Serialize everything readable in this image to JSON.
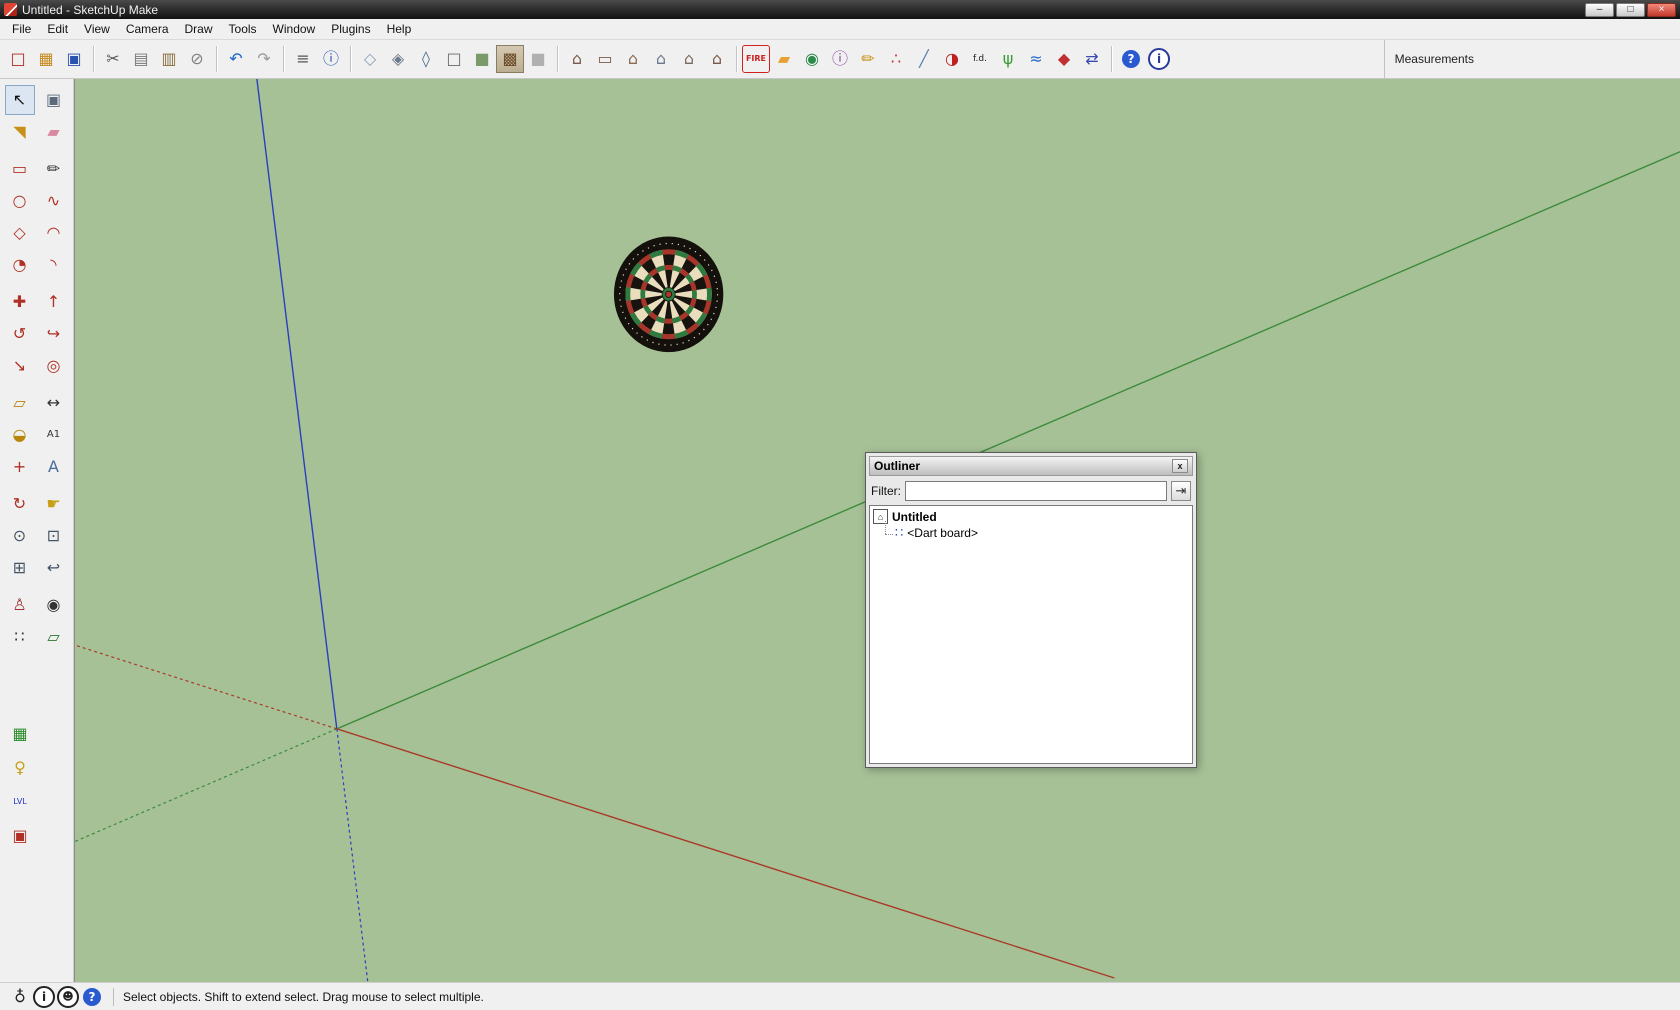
{
  "window": {
    "title": "Untitled - SketchUp Make",
    "minimize_glyph": "–",
    "maximize_glyph": "□",
    "close_glyph": "×"
  },
  "menu": {
    "items": [
      {
        "name": "menu-file",
        "label": "File"
      },
      {
        "name": "menu-edit",
        "label": "Edit"
      },
      {
        "name": "menu-view",
        "label": "View"
      },
      {
        "name": "menu-camera",
        "label": "Camera"
      },
      {
        "name": "menu-draw",
        "label": "Draw"
      },
      {
        "name": "menu-tools",
        "label": "Tools"
      },
      {
        "name": "menu-window",
        "label": "Window"
      },
      {
        "name": "menu-plugins",
        "label": "Plugins"
      },
      {
        "name": "menu-help",
        "label": "Help"
      }
    ]
  },
  "toolbar": {
    "standard_file": [
      {
        "name": "new-button",
        "glyph": "□",
        "color": "#b02a20"
      },
      {
        "name": "open-button",
        "glyph": "▦",
        "color": "#c8881e"
      },
      {
        "name": "save-button",
        "glyph": "▣",
        "color": "#2a52b0"
      }
    ],
    "standard_edit": [
      {
        "name": "cut-button",
        "glyph": "✂",
        "color": "#555555"
      },
      {
        "name": "copy-button",
        "glyph": "▤",
        "color": "#777777"
      },
      {
        "name": "paste-button",
        "glyph": "▥",
        "color": "#8a6d3b"
      },
      {
        "name": "erase-button",
        "glyph": "⊘",
        "color": "#808080"
      }
    ],
    "standard_undo": [
      {
        "name": "undo-button",
        "glyph": "↶",
        "color": "#1a66c8"
      },
      {
        "name": "redo-button",
        "glyph": "↷",
        "color": "#9a9a9a"
      }
    ],
    "standard_print": [
      {
        "name": "print-button",
        "glyph": "≡",
        "color": "#555555"
      },
      {
        "name": "model-info-button",
        "glyph": "ⓘ",
        "color": "#2a52b0"
      }
    ],
    "styles": [
      {
        "name": "style-xray-button",
        "glyph": "◇",
        "color": "#8aa0b8"
      },
      {
        "name": "style-back-edges-button",
        "glyph": "◈",
        "color": "#6a7a8a"
      },
      {
        "name": "style-wireframe-button",
        "glyph": "◊",
        "color": "#4a6a8a"
      },
      {
        "name": "style-hidden-line-button",
        "glyph": "□",
        "color": "#6a6a6a"
      },
      {
        "name": "style-shaded-button",
        "glyph": "■",
        "color": "#7a9a6a"
      },
      {
        "name": "style-shaded-textures-button",
        "glyph": "▩",
        "color": "#6a4a28",
        "cls": "tbtn pressed"
      },
      {
        "name": "style-monochrome-button",
        "glyph": "■",
        "color": "#b0b0b0"
      }
    ],
    "views": [
      {
        "name": "view-iso-button",
        "glyph": "⌂",
        "color": "#7a5a4a"
      },
      {
        "name": "view-top-button",
        "glyph": "▭",
        "color": "#7a5a4a"
      },
      {
        "name": "view-front-button",
        "glyph": "⌂",
        "color": "#8a6a50"
      },
      {
        "name": "view-right-button",
        "glyph": "⌂",
        "color": "#6a7a8a"
      },
      {
        "name": "view-back-button",
        "glyph": "⌂",
        "color": "#7a6a5a"
      },
      {
        "name": "view-left-button",
        "glyph": "⌂",
        "color": "#7a5a4a"
      }
    ],
    "plugins": [
      {
        "name": "fire-plugin-button",
        "glyph": "FIRE",
        "color": "#d02020",
        "fs": "8px",
        "cls": "tbtn boxed"
      },
      {
        "name": "folder-plugin-button",
        "glyph": "▰",
        "color": "#e8a030"
      },
      {
        "name": "add-location-button",
        "glyph": "◉",
        "color": "#2a8a4a"
      },
      {
        "name": "model-info-plugin-button",
        "glyph": "ⓘ",
        "color": "#8a4aa0"
      },
      {
        "name": "pencil-plugin-button",
        "glyph": "✏",
        "color": "#c89018"
      },
      {
        "name": "colors-plugin-button",
        "glyph": "∴",
        "color": "#c03030"
      },
      {
        "name": "eyedropper-plugin-button",
        "glyph": "╱",
        "color": "#5a80b0"
      },
      {
        "name": "contrast-plugin-button",
        "glyph": "◑",
        "color": "#c02020"
      },
      {
        "name": "fd-ruler-plugin-button",
        "glyph": "f.d.",
        "color": "#222222",
        "fs": "9px"
      },
      {
        "name": "grass-plugin-button",
        "glyph": "ψ",
        "color": "#3a9a3a"
      },
      {
        "name": "water-plugin-button",
        "glyph": "≈",
        "color": "#2a6ac8"
      },
      {
        "name": "shield-plugin-button",
        "glyph": "◆",
        "color": "#c03030"
      },
      {
        "name": "export-plugin-button",
        "glyph": "⇄",
        "color": "#3a4ab0"
      }
    ],
    "help": [
      {
        "name": "help-button",
        "glyph": "?",
        "color": "#ffffff",
        "bg": "#2a5ad0",
        "cls": "tbtn round"
      },
      {
        "name": "info-button",
        "glyph": "i",
        "color": "#2a3a9a",
        "cls": "tbtn round ring"
      }
    ],
    "measurements_label": "Measurements",
    "measurements_value": ""
  },
  "left_toolbar": {
    "principal": [
      {
        "name": "select-tool",
        "glyph": "↖",
        "color": "#111111",
        "cls": "tbtn pressed-tool"
      },
      {
        "name": "make-component-tool",
        "glyph": "▣",
        "color": "#5a6a7a"
      },
      {
        "name": "paint-bucket-tool",
        "glyph": "◥",
        "color": "#c89018"
      },
      {
        "name": "eraser-tool",
        "glyph": "▰",
        "color": "#d889a0"
      }
    ],
    "drawing": [
      {
        "name": "rectangle-tool",
        "glyph": "▭",
        "color": "#b03025"
      },
      {
        "name": "line-tool",
        "glyph": "✏",
        "color": "#333333"
      },
      {
        "name": "circle-tool",
        "glyph": "○",
        "color": "#b03025"
      },
      {
        "name": "freehand-tool",
        "glyph": "∿",
        "color": "#b03025"
      },
      {
        "name": "polygon-tool",
        "glyph": "◇",
        "color": "#b03025"
      },
      {
        "name": "arc-tool",
        "glyph": "◠",
        "color": "#b03025"
      },
      {
        "name": "pie-tool",
        "glyph": "◔",
        "color": "#b03025"
      },
      {
        "name": "two-point-arc-tool",
        "glyph": "◝",
        "color": "#b03025"
      }
    ],
    "modification": [
      {
        "name": "move-tool",
        "glyph": "✚",
        "color": "#b03025"
      },
      {
        "name": "push-pull-tool",
        "glyph": "↑",
        "color": "#b03025"
      },
      {
        "name": "rotate-tool",
        "glyph": "↺",
        "color": "#b03025"
      },
      {
        "name": "follow-me-tool",
        "glyph": "↪",
        "color": "#b03025"
      },
      {
        "name": "scale-tool",
        "glyph": "↘",
        "color": "#b03025"
      },
      {
        "name": "offset-tool",
        "glyph": "◎",
        "color": "#b03025"
      }
    ],
    "construction": [
      {
        "name": "tape-measure-tool",
        "glyph": "▱",
        "color": "#b8860b"
      },
      {
        "name": "dimension-tool",
        "glyph": "↔",
        "color": "#333333"
      },
      {
        "name": "protractor-tool",
        "glyph": "◒",
        "color": "#b8860b"
      },
      {
        "name": "text-tool",
        "glyph": "A1",
        "color": "#333333",
        "fs": "10px"
      },
      {
        "name": "axes-tool",
        "glyph": "+",
        "color": "#b03025"
      },
      {
        "name": "3d-text-tool",
        "glyph": "A",
        "color": "#4a6a9a"
      }
    ],
    "camera": [
      {
        "name": "orbit-tool",
        "glyph": "↻",
        "color": "#b03025"
      },
      {
        "name": "pan-tool",
        "glyph": "☛",
        "color": "#c8a018"
      },
      {
        "name": "zoom-tool",
        "glyph": "⊙",
        "color": "#445566"
      },
      {
        "name": "zoom-window-tool",
        "glyph": "⊡",
        "color": "#445566"
      },
      {
        "name": "zoom-extents-tool",
        "glyph": "⊞",
        "color": "#445566"
      },
      {
        "name": "zoom-previous-tool",
        "glyph": "↩",
        "color": "#445566"
      }
    ],
    "walkthrough": [
      {
        "name": "position-camera-tool",
        "glyph": "♙",
        "color": "#a03030"
      },
      {
        "name": "look-around-tool",
        "glyph": "◉",
        "color": "#333333"
      },
      {
        "name": "walk-tool",
        "glyph": "∷",
        "color": "#333333"
      },
      {
        "name": "section-plane-tool",
        "glyph": "▱",
        "color": "#2a7a2a"
      }
    ],
    "plugins": [
      {
        "name": "plugin-building-tool",
        "glyph": "▦",
        "color": "#2a8a2a"
      },
      {
        "name": "plugin-lamp-tool",
        "glyph": "♀",
        "color": "#c8a018"
      },
      {
        "name": "plugin-lvl-tool",
        "glyph": "LVL",
        "color": "#2233cc",
        "fs": "8px"
      },
      {
        "name": "plugin-box-tool",
        "glyph": "▣",
        "color": "#b03025"
      }
    ]
  },
  "viewport": {
    "background_color": "#a7c197",
    "axis_red_color": "#a83a28",
    "axis_green_color": "#3c8a3c",
    "axis_blue_color": "#2a3fbf",
    "object_label": "Dart board"
  },
  "outliner": {
    "title": "Outliner",
    "close_glyph": "x",
    "filter_label": "Filter:",
    "filter_value": "",
    "filter_go_glyph": "⇥",
    "root_icon_glyph": "⌂",
    "root_label": "Untitled",
    "child_icon_glyph": "∷",
    "child_label": "<Dart board>"
  },
  "statusbar": {
    "icons": [
      {
        "name": "geolocation-button",
        "glyph": "♁",
        "color": "#222222"
      },
      {
        "name": "credits-button",
        "glyph": "i",
        "color": "#222222",
        "bg": "#ffffff",
        "cls": "tbtn round ring"
      },
      {
        "name": "user-account-button",
        "glyph": "☻",
        "color": "#222222",
        "bg": "#ffffff",
        "fs": "11px",
        "cls": "tbtn round ring"
      },
      {
        "name": "help-status-button",
        "glyph": "?",
        "color": "#ffffff",
        "bg": "#2a5ad0",
        "cls": "tbtn round"
      }
    ],
    "text": "Select objects. Shift to extend select. Drag mouse to select multiple."
  }
}
